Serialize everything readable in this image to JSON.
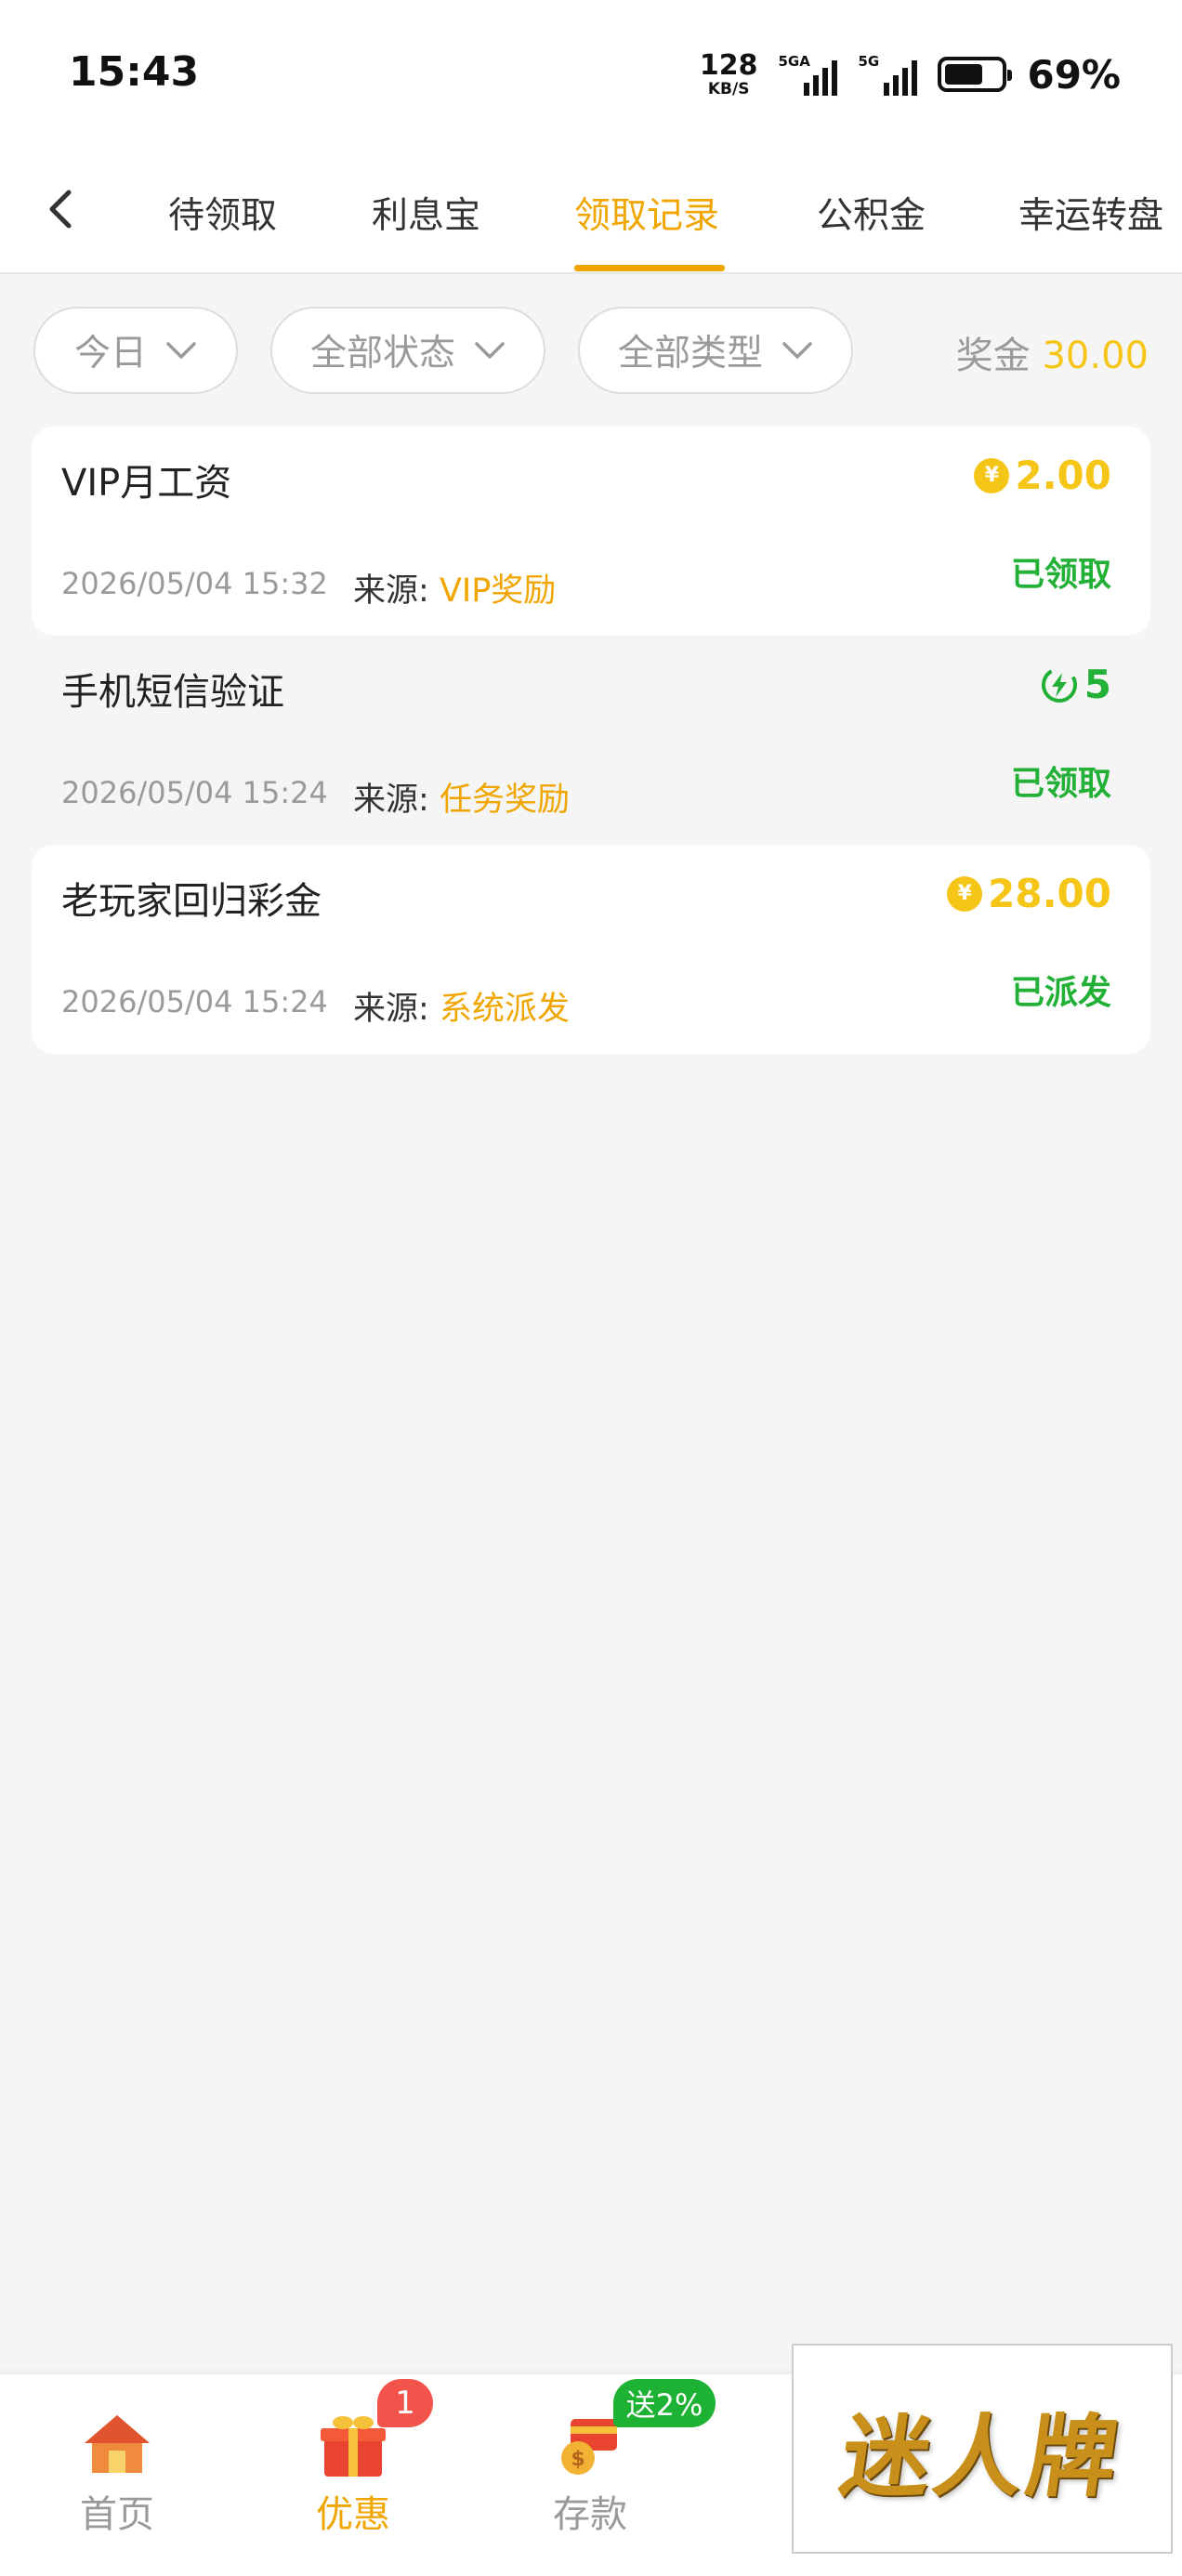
{
  "status_bar": {
    "time": "15:43",
    "net_speed_value": "128",
    "net_speed_unit": "KB/S",
    "signal1_label": "5GA",
    "signal2_label": "5G",
    "battery_percent": "69%",
    "battery_level": 0.69
  },
  "nav": {
    "tabs": [
      {
        "label": "待领取"
      },
      {
        "label": "利息宝"
      },
      {
        "label": "领取记录"
      },
      {
        "label": "公积金"
      },
      {
        "label": "幸运转盘"
      }
    ],
    "active_tab": "领取记录"
  },
  "filters": {
    "date": "今日",
    "status": "全部状态",
    "type": "全部类型"
  },
  "bonus": {
    "label": "奖金",
    "amount": "30.00"
  },
  "records": [
    {
      "title": "VIP月工资",
      "amount": "2.00",
      "amount_icon": "coin-icon",
      "date": "2026/05/04 15:32",
      "source_label": "来源:",
      "source": "VIP奖励",
      "status": "已领取"
    },
    {
      "title": "手机短信验证",
      "amount": "5",
      "amount_icon": "bolt-icon",
      "date": "2026/05/04 15:24",
      "source_label": "来源:",
      "source": "任务奖励",
      "status": "已领取"
    },
    {
      "title": "老玩家回归彩金",
      "amount": "28.00",
      "amount_icon": "coin-icon",
      "date": "2026/05/04 15:24",
      "source_label": "来源:",
      "source": "系统派发",
      "status": "已派发"
    }
  ],
  "coin_symbol": "¥",
  "bottom_nav": {
    "items": [
      {
        "label": "首页",
        "icon": "house-icon"
      },
      {
        "label": "优惠",
        "icon": "gift-icon"
      },
      {
        "label": "存款",
        "icon": "deposit-icon"
      }
    ],
    "active": "优惠",
    "promo_badge": "1",
    "deposit_badge": "送2%"
  },
  "promo_overlay_text": "迷人牌",
  "colors": {
    "accent": "#f0a500",
    "gold": "#f5c518",
    "green": "#22b036",
    "badge_red": "#f2544b",
    "background": "#f5f5f5"
  }
}
